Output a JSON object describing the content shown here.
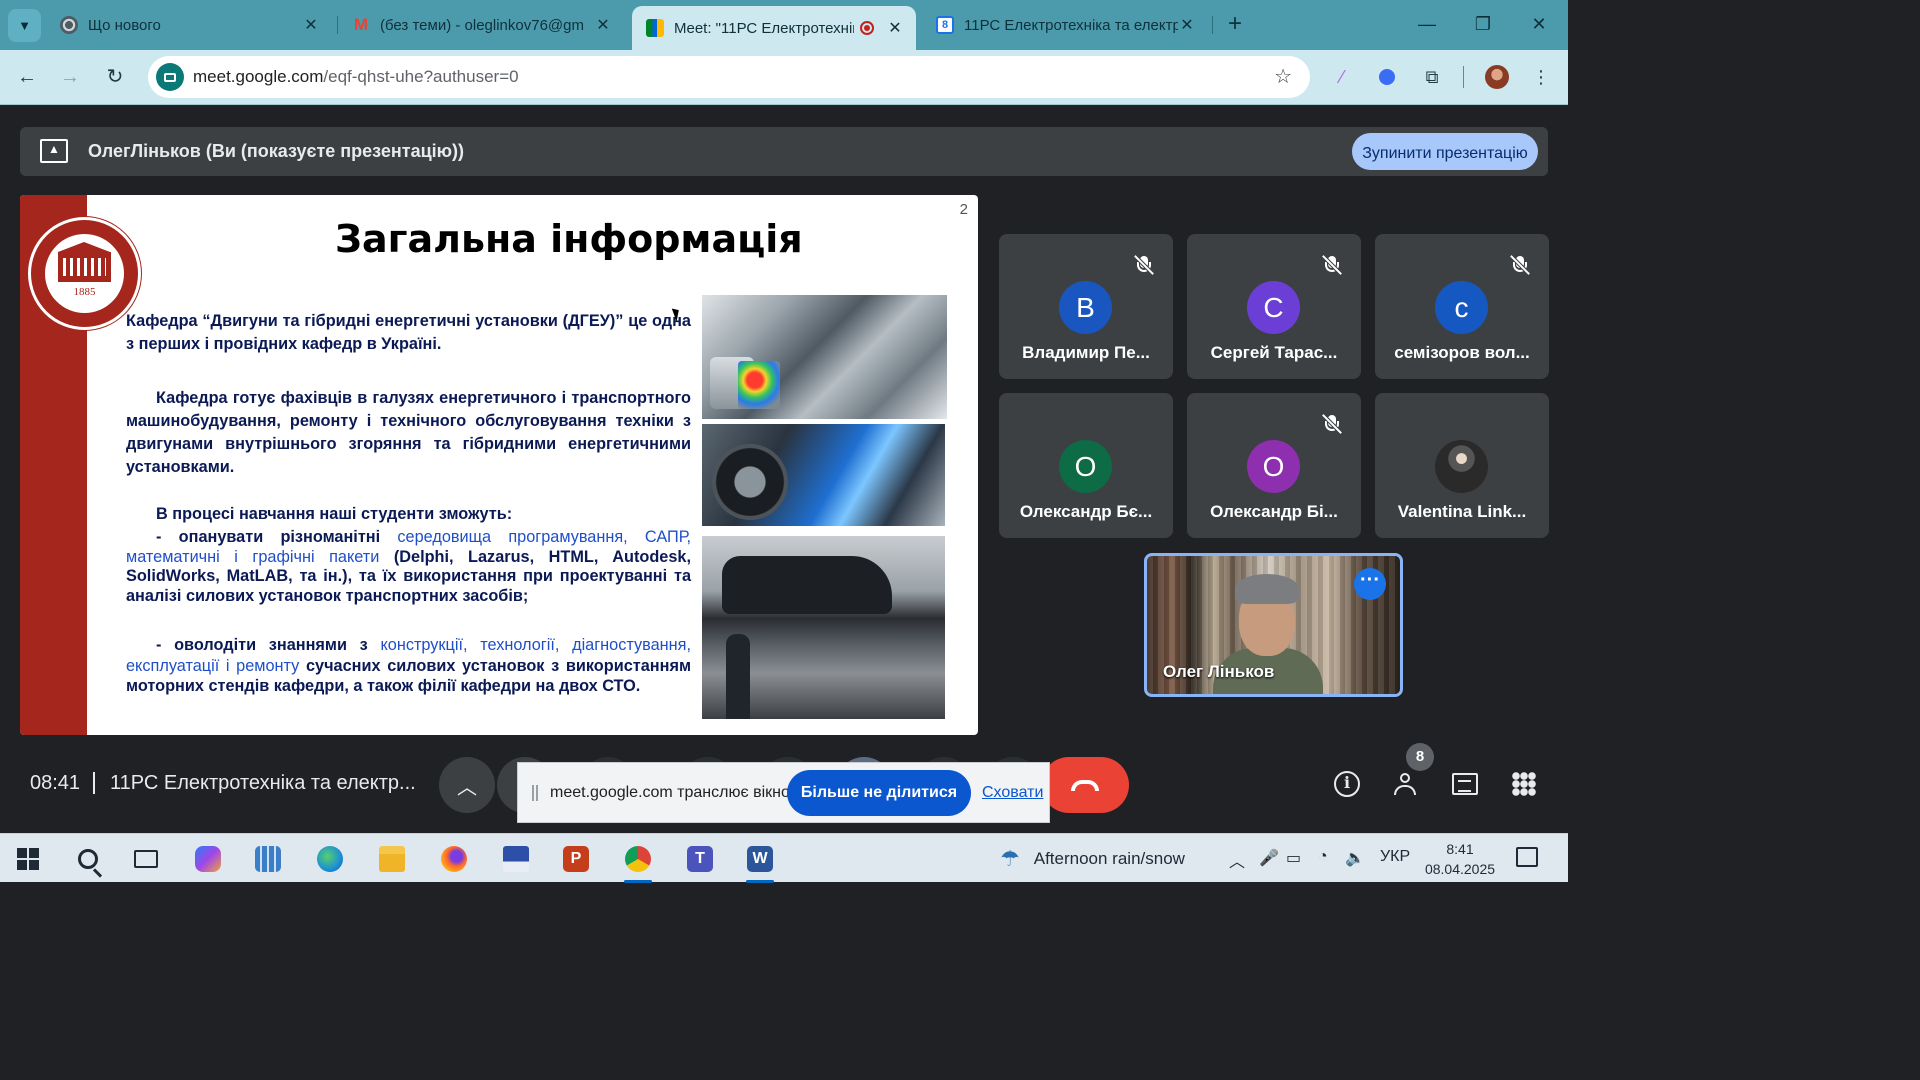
{
  "browser": {
    "tabs": [
      {
        "title": "Що нового",
        "icon": "chrome-icon"
      },
      {
        "title": "(без теми) - oleglinkov76@gm",
        "icon": "gmail-icon"
      },
      {
        "title": "Meet: \"11РС Електротехніка",
        "icon": "google-meet-icon",
        "active": true
      },
      {
        "title": "11РС Електротехніка та електр",
        "icon": "google-calendar-icon",
        "icon_label": "8"
      }
    ],
    "url_host": "meet.google.com",
    "url_path": "/eqf-qhst-uhe?authuser=0"
  },
  "meet": {
    "presenting_text": "ОлегЛіньков (Ви (показуєте презентацію))",
    "stop_presenting_label": "Зупинити презентацію",
    "time": "08:41",
    "meeting_title": "11РС Електротехніка та електр...",
    "participant_count": "8",
    "participants": [
      {
        "initial": "В",
        "name": "Владимир Пе...",
        "color": "#1a56c0",
        "muted": true
      },
      {
        "initial": "С",
        "name": "Сергей Тарас...",
        "color": "#6b3fd6",
        "muted": true
      },
      {
        "initial": "с",
        "name": "семізоров вол...",
        "color": "#1658c2",
        "muted": true
      },
      {
        "initial": "О",
        "name": "Олександр Бє...",
        "color": "#0d6b45",
        "muted": false
      },
      {
        "initial": "О",
        "name": "Олександр Бі...",
        "color": "#8e2fb0",
        "muted": true
      },
      {
        "initial": "",
        "name": "Valentina Link...",
        "color": "#2a2a2a",
        "muted": false,
        "photo": true
      }
    ],
    "self_name": "Олег Ліньков",
    "share_notice": {
      "text": "meet.google.com транслює вікно.",
      "stop_label": "Більше не ділитися",
      "hide_label": "Сховати"
    }
  },
  "slide": {
    "number": "2",
    "title": "Загальна інформація",
    "logo_year": "1885",
    "p1": "Кафедра “Двигуни та гібридні енергетичні установки (ДГЕУ)” це одна з перших і провідних кафедр в Україні.",
    "p2": "Кафедра готує фахівців в галузях енергетичного і транспортного машинобудування, ремонту і технічного обслуговування техніки з двигунами внутрішнього згоряння та гібридними енергетичними установками.",
    "p3": "В процесі навчання наші студенти зможуть:",
    "b1_prefix": "- опанувати різноманітні ",
    "b1_blue": "середовища програмування, САПР, математичні і графічні пакети",
    "b1_rest": " (Delphi, Lazarus, HTML, Autodesk, SolidWorks, MatLAB, та ін.), та їх використання при проектуванні та аналізі силових установок транспортних засобів;",
    "b2_prefix": "- оволодіти знаннями з ",
    "b2_blue": "конструкції, технології, діагностування, експлуатації і ремонту",
    "b2_rest": " сучасних силових установок з використанням моторних стендів кафедри, а також філії кафедри на двох СТО."
  },
  "taskbar": {
    "weather": "Afternoon rain/snow",
    "language": "УКР",
    "time": "8:41",
    "date": "08.04.2025"
  }
}
